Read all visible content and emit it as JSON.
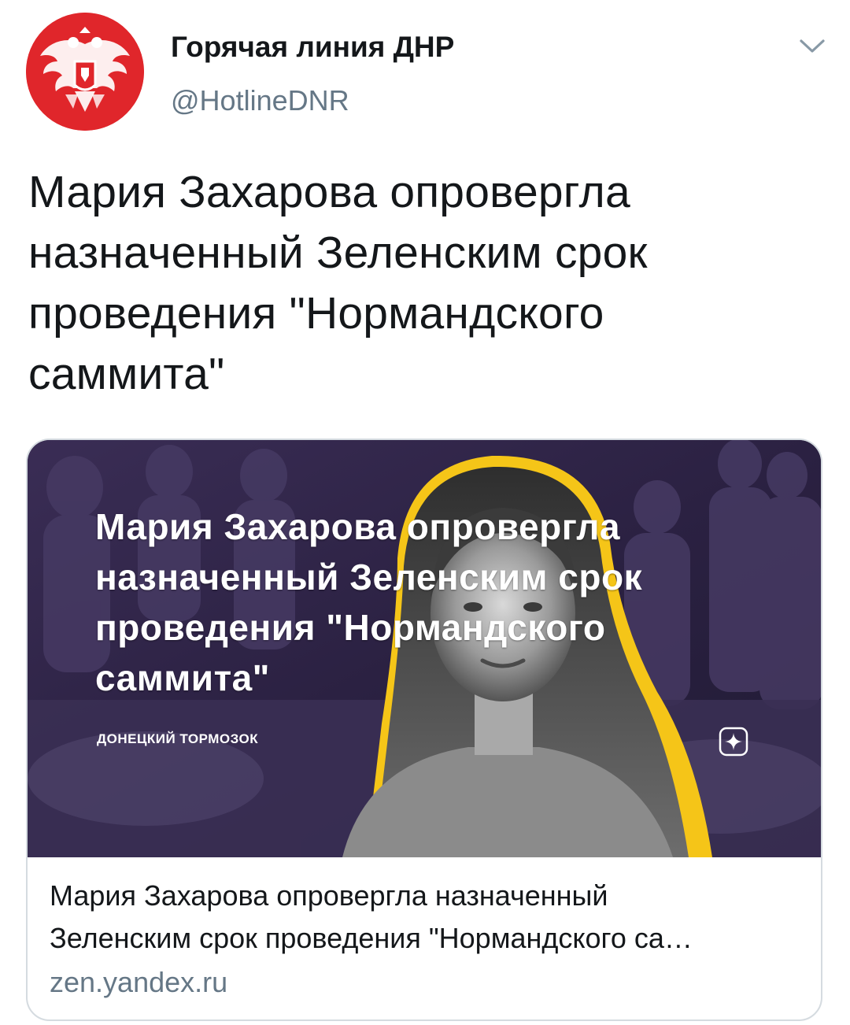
{
  "author": {
    "display_name": "Горячая линия ДНР",
    "handle": "@HotlineDNR",
    "avatar_icon": "dnr-coat-of-arms-icon",
    "avatar_color": "#e0262b"
  },
  "menu": {
    "icon": "chevron-down-icon"
  },
  "tweet": {
    "lines": [
      "Мария Захарова опровергла",
      "назначенный Зеленским срок",
      "проведения \"Нормандского",
      "саммита\""
    ]
  },
  "card": {
    "image": {
      "headline_lines": [
        "Мария Захарова опровергла",
        "назначенный Зеленским срок",
        "проведения \"Нормандского",
        "саммита\""
      ],
      "source_label": "ДОНЕЦКИЙ ТОРМОЗОК",
      "source_icon": "zen-logo-icon",
      "accent_color": "#f5c518"
    },
    "title_lines": [
      "Мария Захарова опровергла назначенный",
      "Зеленским срок проведения \"Нормандского са…"
    ],
    "domain": "zen.yandex.ru"
  },
  "colors": {
    "text_primary": "#14171a",
    "text_secondary": "#657786",
    "border": "#d5dbe0"
  }
}
